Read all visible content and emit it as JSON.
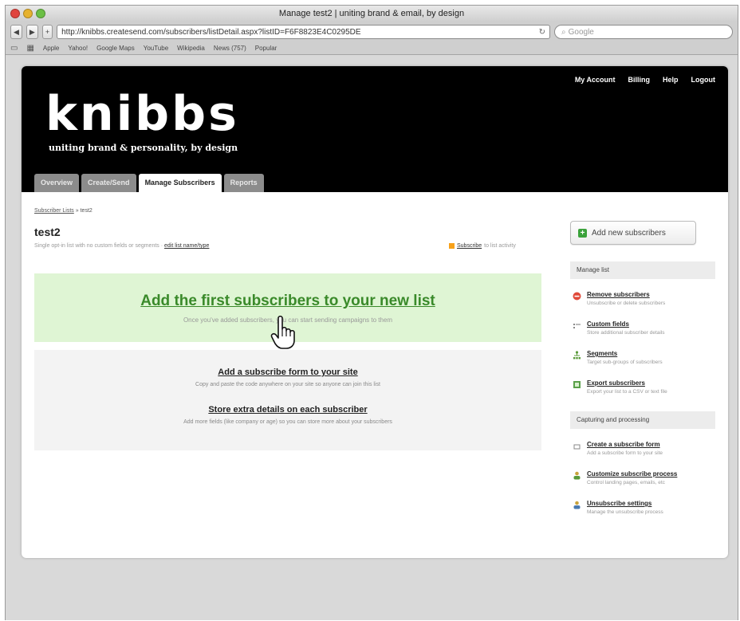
{
  "browser": {
    "window_title": "Manage test2 | uniting brand & email, by design",
    "url": "http://knibbs.createsend.com/subscribers/listDetail.aspx?listID=F6F8823E4C0295DE",
    "search_placeholder": "Google",
    "bookmarks": [
      "Apple",
      "Yahoo!",
      "Google Maps",
      "YouTube",
      "Wikipedia",
      "News (757)",
      "Popular"
    ]
  },
  "header": {
    "logo": "knibbs",
    "tagline": "uniting brand & personality, by design",
    "nav": [
      "My Account",
      "Billing",
      "Help",
      "Logout"
    ],
    "tabs": [
      {
        "label": "Overview"
      },
      {
        "label": "Create/Send"
      },
      {
        "label": "Manage Subscribers"
      },
      {
        "label": "Reports"
      }
    ]
  },
  "breadcrumb": {
    "parent": "Subscriber Lists",
    "separator": "»",
    "current": "test2"
  },
  "list": {
    "title": "test2",
    "description": "Single opt-in list with no custom fields or segments ·",
    "edit_link": "edit list name/type",
    "subscribe_link": "Subscribe",
    "subscribe_suffix": "to list activity"
  },
  "hero": {
    "title": "Add the first subscribers to your new list",
    "subtitle": "Once you've added subscribers, you can start sending campaigns to them"
  },
  "options": [
    {
      "title": "Add a subscribe form to your site",
      "desc": "Copy and paste the code anywhere on your site so anyone can join this list"
    },
    {
      "title": "Store extra details on each subscriber",
      "desc": "Add more fields (like company or age) so you can store more about your subscribers"
    }
  ],
  "sidebar": {
    "add_button": "Add new subscribers",
    "manage_heading": "Manage list",
    "manage_items": [
      {
        "title": "Remove subscribers",
        "desc": "Unsubscribe or delete subscribers",
        "icon": "minus-circle-icon",
        "color": "#e04a3a"
      },
      {
        "title": "Custom fields",
        "desc": "Store additional subscriber details",
        "icon": "fields-icon",
        "color": "#888888"
      },
      {
        "title": "Segments",
        "desc": "Target sub-groups of subscribers",
        "icon": "segments-icon",
        "color": "#5a9a3a"
      },
      {
        "title": "Export subscribers",
        "desc": "Export your list to a CSV or text file",
        "icon": "export-icon",
        "color": "#5aa04a"
      }
    ],
    "capture_heading": "Capturing and processing",
    "capture_items": [
      {
        "title": "Create a subscribe form",
        "desc": "Add a subscribe form to your site",
        "icon": "form-icon",
        "color": "#888888"
      },
      {
        "title": "Customize subscribe process",
        "desc": "Control landing pages, emails, etc",
        "icon": "user-icon",
        "color": "#c9a33a"
      },
      {
        "title": "Unsubscribe settings",
        "desc": "Manage the unsubscribe process",
        "icon": "user-settings-icon",
        "color": "#c9a33a"
      }
    ]
  },
  "colors": {
    "accent_green": "#3a8a2a",
    "hero_bg": "#dff5d4",
    "header_bg": "#000000"
  }
}
